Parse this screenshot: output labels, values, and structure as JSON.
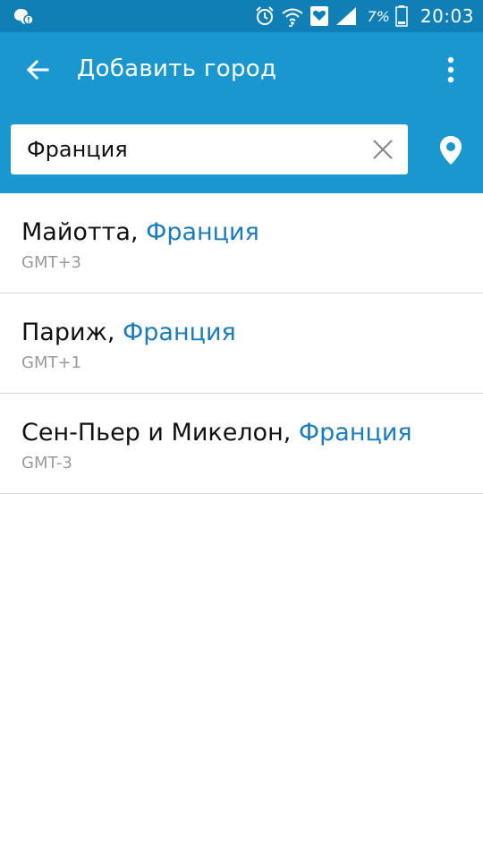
{
  "colors": {
    "status_bar": "#0f7fb5",
    "app_bar": "#1b97cf",
    "country_accent": "#1a7bbf",
    "timezone_text": "#9a9a9a",
    "divider": "#d6d6d6"
  },
  "status_bar": {
    "battery_percent": "7%",
    "time": "20:03",
    "icons": [
      "notification-icon",
      "alarm-icon",
      "wifi-icon",
      "health-icon",
      "signal-icon",
      "battery-icon"
    ]
  },
  "app_bar": {
    "title": "Добавить город",
    "icons": [
      "back-arrow-icon",
      "more-vert-icon"
    ]
  },
  "search": {
    "value": "Франция",
    "icons": [
      "clear-icon",
      "location-pin-icon"
    ]
  },
  "results": [
    {
      "city": "Майотта",
      "separator": ", ",
      "country": "Франция",
      "timezone": "GMT+3"
    },
    {
      "city": "Париж",
      "separator": ", ",
      "country": "Франция",
      "timezone": "GMT+1"
    },
    {
      "city": "Сен-Пьер и Микелон",
      "separator": ", ",
      "country": "Франция",
      "timezone": "GMT-3"
    }
  ]
}
